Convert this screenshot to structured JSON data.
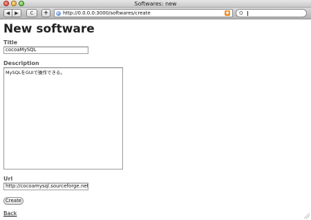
{
  "window": {
    "title": "Softwares: new"
  },
  "toolbar": {
    "back_icon": "◀",
    "forward_icon": "▶",
    "reload_icon": "C",
    "add_icon": "+",
    "url": "http://0.0.0.0:3000/softwares/create",
    "rss_icon": "rss-icon",
    "search_icon_glyph": "Q",
    "search_value": ""
  },
  "page": {
    "heading": "New software",
    "title_label": "Title",
    "title_value": "cocoaMySQL",
    "description_label": "Description",
    "description_value": "MySQLをGUIで操作できる。",
    "url_label": "Url",
    "url_value": "http://cocoamysql.sourceforge.net/",
    "create_button": "Create",
    "back_link": "Back"
  }
}
